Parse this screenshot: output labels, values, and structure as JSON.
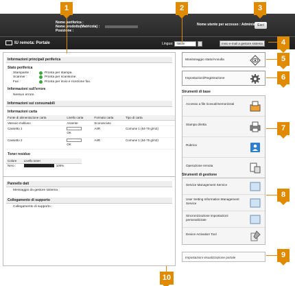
{
  "header": {
    "printer_name_label": "Nome periferica :",
    "product_name_label": "Nome prodotto(Matricola) :",
    "position_label": "Posizione :",
    "user_label": "Nome utente per accesso :",
    "user_value": "Administrator",
    "logout": "Esci",
    "app_title": "IU remota: Portale",
    "language_label": "Lingua:",
    "language_value": "Italian",
    "mail_button": "Invio e-mail a gestore sistema"
  },
  "left": {
    "device_info_heading": "Informazioni principali periferica",
    "status_heading": "Stato periferica",
    "status_rows": [
      {
        "k": "Stampante :",
        "v": "Pronta per stampa."
      },
      {
        "k": "Scanner :",
        "v": "Pronta per scansione."
      },
      {
        "k": "Fax :",
        "v": "Pronta per invio e ricezione fax."
      }
    ],
    "error_heading": "Informazioni sull'errore",
    "error_value": "Nessun errore.",
    "consumables_heading": "Informazioni sui consumabili",
    "paper_heading": "Informazioni carta",
    "paper_cols": [
      "Fonte di alimentazione carta",
      "Livello carta",
      "Formato carta",
      "Tipo di carta"
    ],
    "paper_rows": [
      {
        "src": "Vassoio multiuso",
        "lvl": "Assente",
        "fmt": "Sconosciuto",
        "type": ""
      },
      {
        "src": "Cassetto 1",
        "lvl": "OK",
        "fmt": "A4R",
        "type": "Comune 1 (64-75 g/m2)"
      },
      {
        "src": "Cassetto 2",
        "lvl": "OK",
        "fmt": "A4R",
        "type": "Comune 1 (64-75 g/m2)"
      }
    ],
    "paper_levels": [
      1.0,
      1.0
    ],
    "toner_heading": "Toner residuo",
    "toner_cols": [
      "Colore",
      "Livello toner"
    ],
    "toner_color": "Nero :",
    "toner_pct": "100%",
    "toner_level": 1.0,
    "messages_heading": "Pannello dati",
    "messages_value": "Messaggio da gestore sistema :",
    "support_heading": "Collegamento di supporto",
    "support_value": "Collegamento di supporto :"
  },
  "right": {
    "monitor": "Monitoraggio stato/Annulla",
    "settings": "Impostazioni/Registrazione",
    "basic_heading": "Strumenti di base",
    "basic_items": [
      "Accesso a file ricevuti/memorizzati",
      "Stampa diretta",
      "Rubrica",
      "Operazione remota"
    ],
    "mgmt_heading": "Strumenti di gestione",
    "mgmt_items": [
      "Service Management Service",
      "User Setting Information Management Service",
      "Sincronizzazione impostazioni personalizzate",
      "Device Activation Tool"
    ],
    "portal_settings": "Impostazioni visualizzazione portale"
  },
  "callouts": [
    "1",
    "2",
    "3",
    "4",
    "5",
    "6",
    "7",
    "8",
    "9",
    "10"
  ],
  "colors": {
    "accent": "#e08a00",
    "header": "#2b2b2b",
    "ready": "#3aa83a"
  }
}
